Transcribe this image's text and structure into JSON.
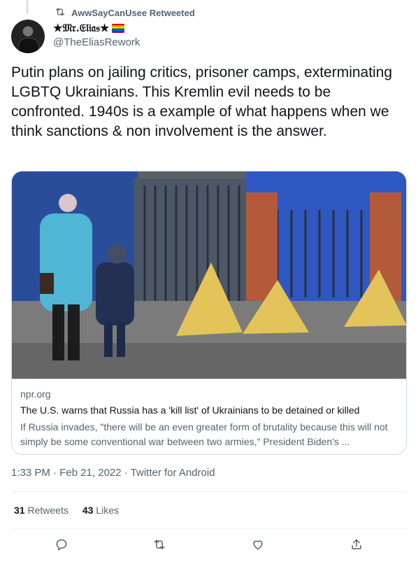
{
  "retweet": {
    "label": "AwwSayCanUsee Retweeted"
  },
  "author": {
    "display_name": "★𝔐𝔯.𝔈𝔩𝔦𝔞𝔰★",
    "handle": "@TheEliasRework"
  },
  "tweet": {
    "text": "Putin plans on jailing critics, prisoner camps, exterminating LGBTQ Ukrainians. This Kremlin evil needs to be confronted. 1940s is a example of what happens when we think sanctions & non involvement is the answer."
  },
  "card": {
    "domain": "npr.org",
    "title": "The U.S. warns that Russia has a 'kill list' of Ukrainians to be detained or killed",
    "description": "If Russia invades, \"there will be an even greater form of brutality because this will not simply be some conventional war between two armies,\" President Biden's ..."
  },
  "meta": {
    "text": "1:33 PM · Feb 21, 2022 · Twitter for Android"
  },
  "stats": {
    "retweets_count": "31",
    "retweets_label": "Retweets",
    "likes_count": "43",
    "likes_label": "Likes"
  },
  "actions": {
    "icons": [
      "reply-icon",
      "retweet-icon",
      "like-icon",
      "share-icon"
    ]
  },
  "colors": {
    "secondary_text": "#536471",
    "primary_text": "#0f1419",
    "border": "#cfd9de"
  }
}
